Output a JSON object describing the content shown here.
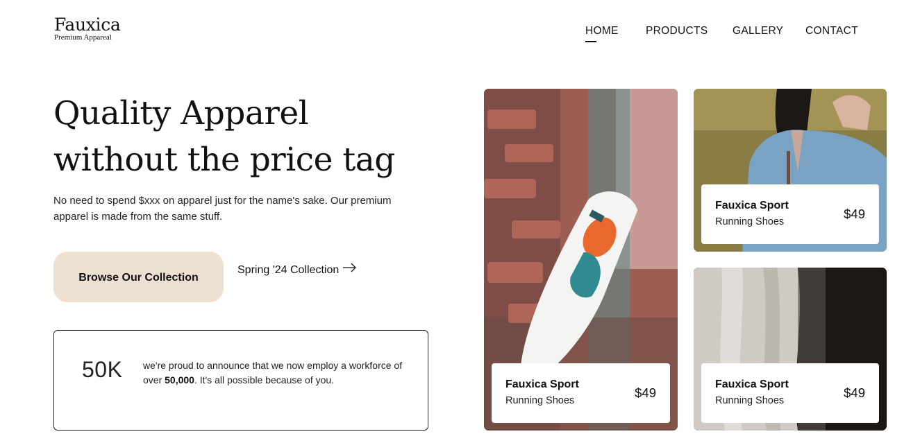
{
  "brand": {
    "name": "Fauxica",
    "tagline": "Premium Appareal"
  },
  "nav": {
    "items": [
      "HOME",
      "PRODUCTS",
      "GALLERY",
      "CONTACT"
    ],
    "active": "HOME"
  },
  "hero": {
    "title": "Quality Apparel without the price tag",
    "description": "No need to spend $xxx on apparel just for the name's sake. Our premium apparel is made from the same stuff.",
    "cta_label": "Browse Our Collection",
    "link_label": "Spring '24 Collection"
  },
  "stat": {
    "number": "50K",
    "text_before": "we're proud to announce that we now employ a workforce of over ",
    "text_bold": "50,000",
    "text_after": ". It's all possible because of you."
  },
  "products": [
    {
      "name": "Fauxica Sport",
      "category": "Running Shoes",
      "price": "$49"
    },
    {
      "name": "Fauxica Sport",
      "category": "Running Shoes",
      "price": "$49"
    },
    {
      "name": "Fauxica Sport",
      "category": "Running Shoes",
      "price": "$49"
    }
  ],
  "colors": {
    "cta_background": "#efe1d2",
    "text": "#111111",
    "background": "#ffffff"
  },
  "icons": {
    "collection_link": "arrow-right-icon"
  }
}
